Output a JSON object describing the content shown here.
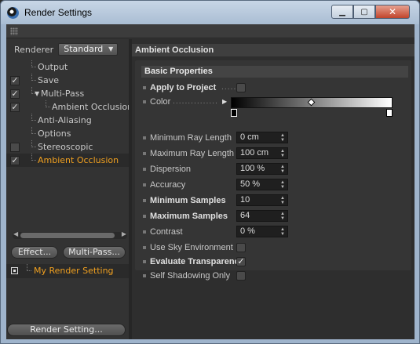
{
  "window": {
    "title": "Render Settings",
    "controls": {
      "minimize": "▁",
      "maximize": "▢",
      "close": "✕"
    }
  },
  "left_panel": {
    "renderer_label": "Renderer",
    "renderer_value": "Standard",
    "tree": [
      {
        "label": "Output",
        "checked": null,
        "indent": 1,
        "active": false
      },
      {
        "label": "Save",
        "checked": true,
        "indent": 1,
        "active": false
      },
      {
        "label": "Multi-Pass",
        "checked": true,
        "indent": 1,
        "active": false,
        "expanded": true
      },
      {
        "label": "Ambient Occlusion",
        "checked": true,
        "indent": 2,
        "active": false
      },
      {
        "label": "Anti-Aliasing",
        "checked": null,
        "indent": 1,
        "active": false
      },
      {
        "label": "Options",
        "checked": null,
        "indent": 1,
        "active": false
      },
      {
        "label": "Stereoscopic",
        "checked": false,
        "indent": 1,
        "active": false
      },
      {
        "label": "Ambient Occlusion",
        "checked": true,
        "indent": 1,
        "active": true
      }
    ],
    "effect_button": "Effect...",
    "multipass_button": "Multi-Pass...",
    "render_setting_name": "My Render Setting",
    "render_setting_button": "Render Setting..."
  },
  "right_panel": {
    "header": "Ambient Occlusion",
    "group": "Basic Properties",
    "apply_to_project": {
      "label": "Apply to Project",
      "checked": false
    },
    "color_label": "Color",
    "fields": [
      {
        "label": "Minimum Ray Length",
        "value": "0 cm",
        "bold": false
      },
      {
        "label": "Maximum Ray Length",
        "value": "100 cm",
        "bold": false
      },
      {
        "label": "Dispersion",
        "value": "100 %",
        "bold": false
      },
      {
        "label": "Accuracy",
        "value": "50 %",
        "bold": false
      },
      {
        "label": "Minimum Samples",
        "value": "10",
        "bold": true
      },
      {
        "label": "Maximum Samples",
        "value": "64",
        "bold": true
      },
      {
        "label": "Contrast",
        "value": "0 %",
        "bold": false
      }
    ],
    "checkboxes": [
      {
        "label": "Use Sky Environment",
        "checked": false,
        "bold": false
      },
      {
        "label": "Evaluate Transparency",
        "checked": true,
        "bold": true
      },
      {
        "label": "Self Shadowing Only",
        "checked": false,
        "bold": false
      }
    ]
  },
  "colors": {
    "accent_orange": "#f0a020",
    "panel_bg": "#323232",
    "title_bar": "#b7c9dd"
  }
}
